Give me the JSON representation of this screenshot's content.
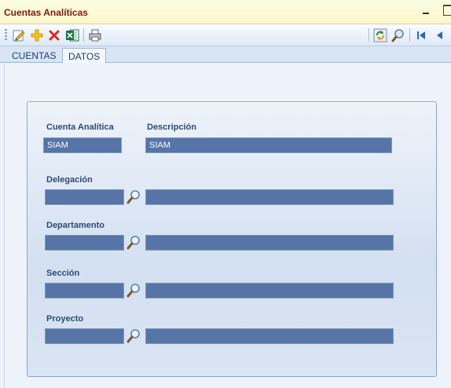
{
  "window": {
    "title": "Cuentas Analíticas"
  },
  "toolbar": {
    "left_icons": [
      "edit-icon",
      "add-icon",
      "delete-icon",
      "excel-icon",
      "print-icon"
    ],
    "right_icons": [
      "refresh-icon",
      "search-icon",
      "first-record-icon",
      "previous-record-icon"
    ]
  },
  "tabs": [
    {
      "label": "CUENTAS",
      "active": false
    },
    {
      "label": "DATOS",
      "active": true
    }
  ],
  "form": {
    "cuenta": {
      "label": "Cuenta Analítica",
      "value": "SIAM"
    },
    "descripcion": {
      "label": "Descripción",
      "value": "SIAM"
    },
    "delegacion": {
      "label": "Delegación",
      "code": "",
      "name": ""
    },
    "departamento": {
      "label": "Departamento",
      "code": "",
      "name": ""
    },
    "seccion": {
      "label": "Sección",
      "code": "",
      "name": ""
    },
    "proyecto": {
      "label": "Proyecto",
      "code": "",
      "name": ""
    }
  },
  "colors": {
    "title_text": "#7a1c12",
    "field_fill": "#5674a5",
    "label_text": "#2c4a72"
  }
}
